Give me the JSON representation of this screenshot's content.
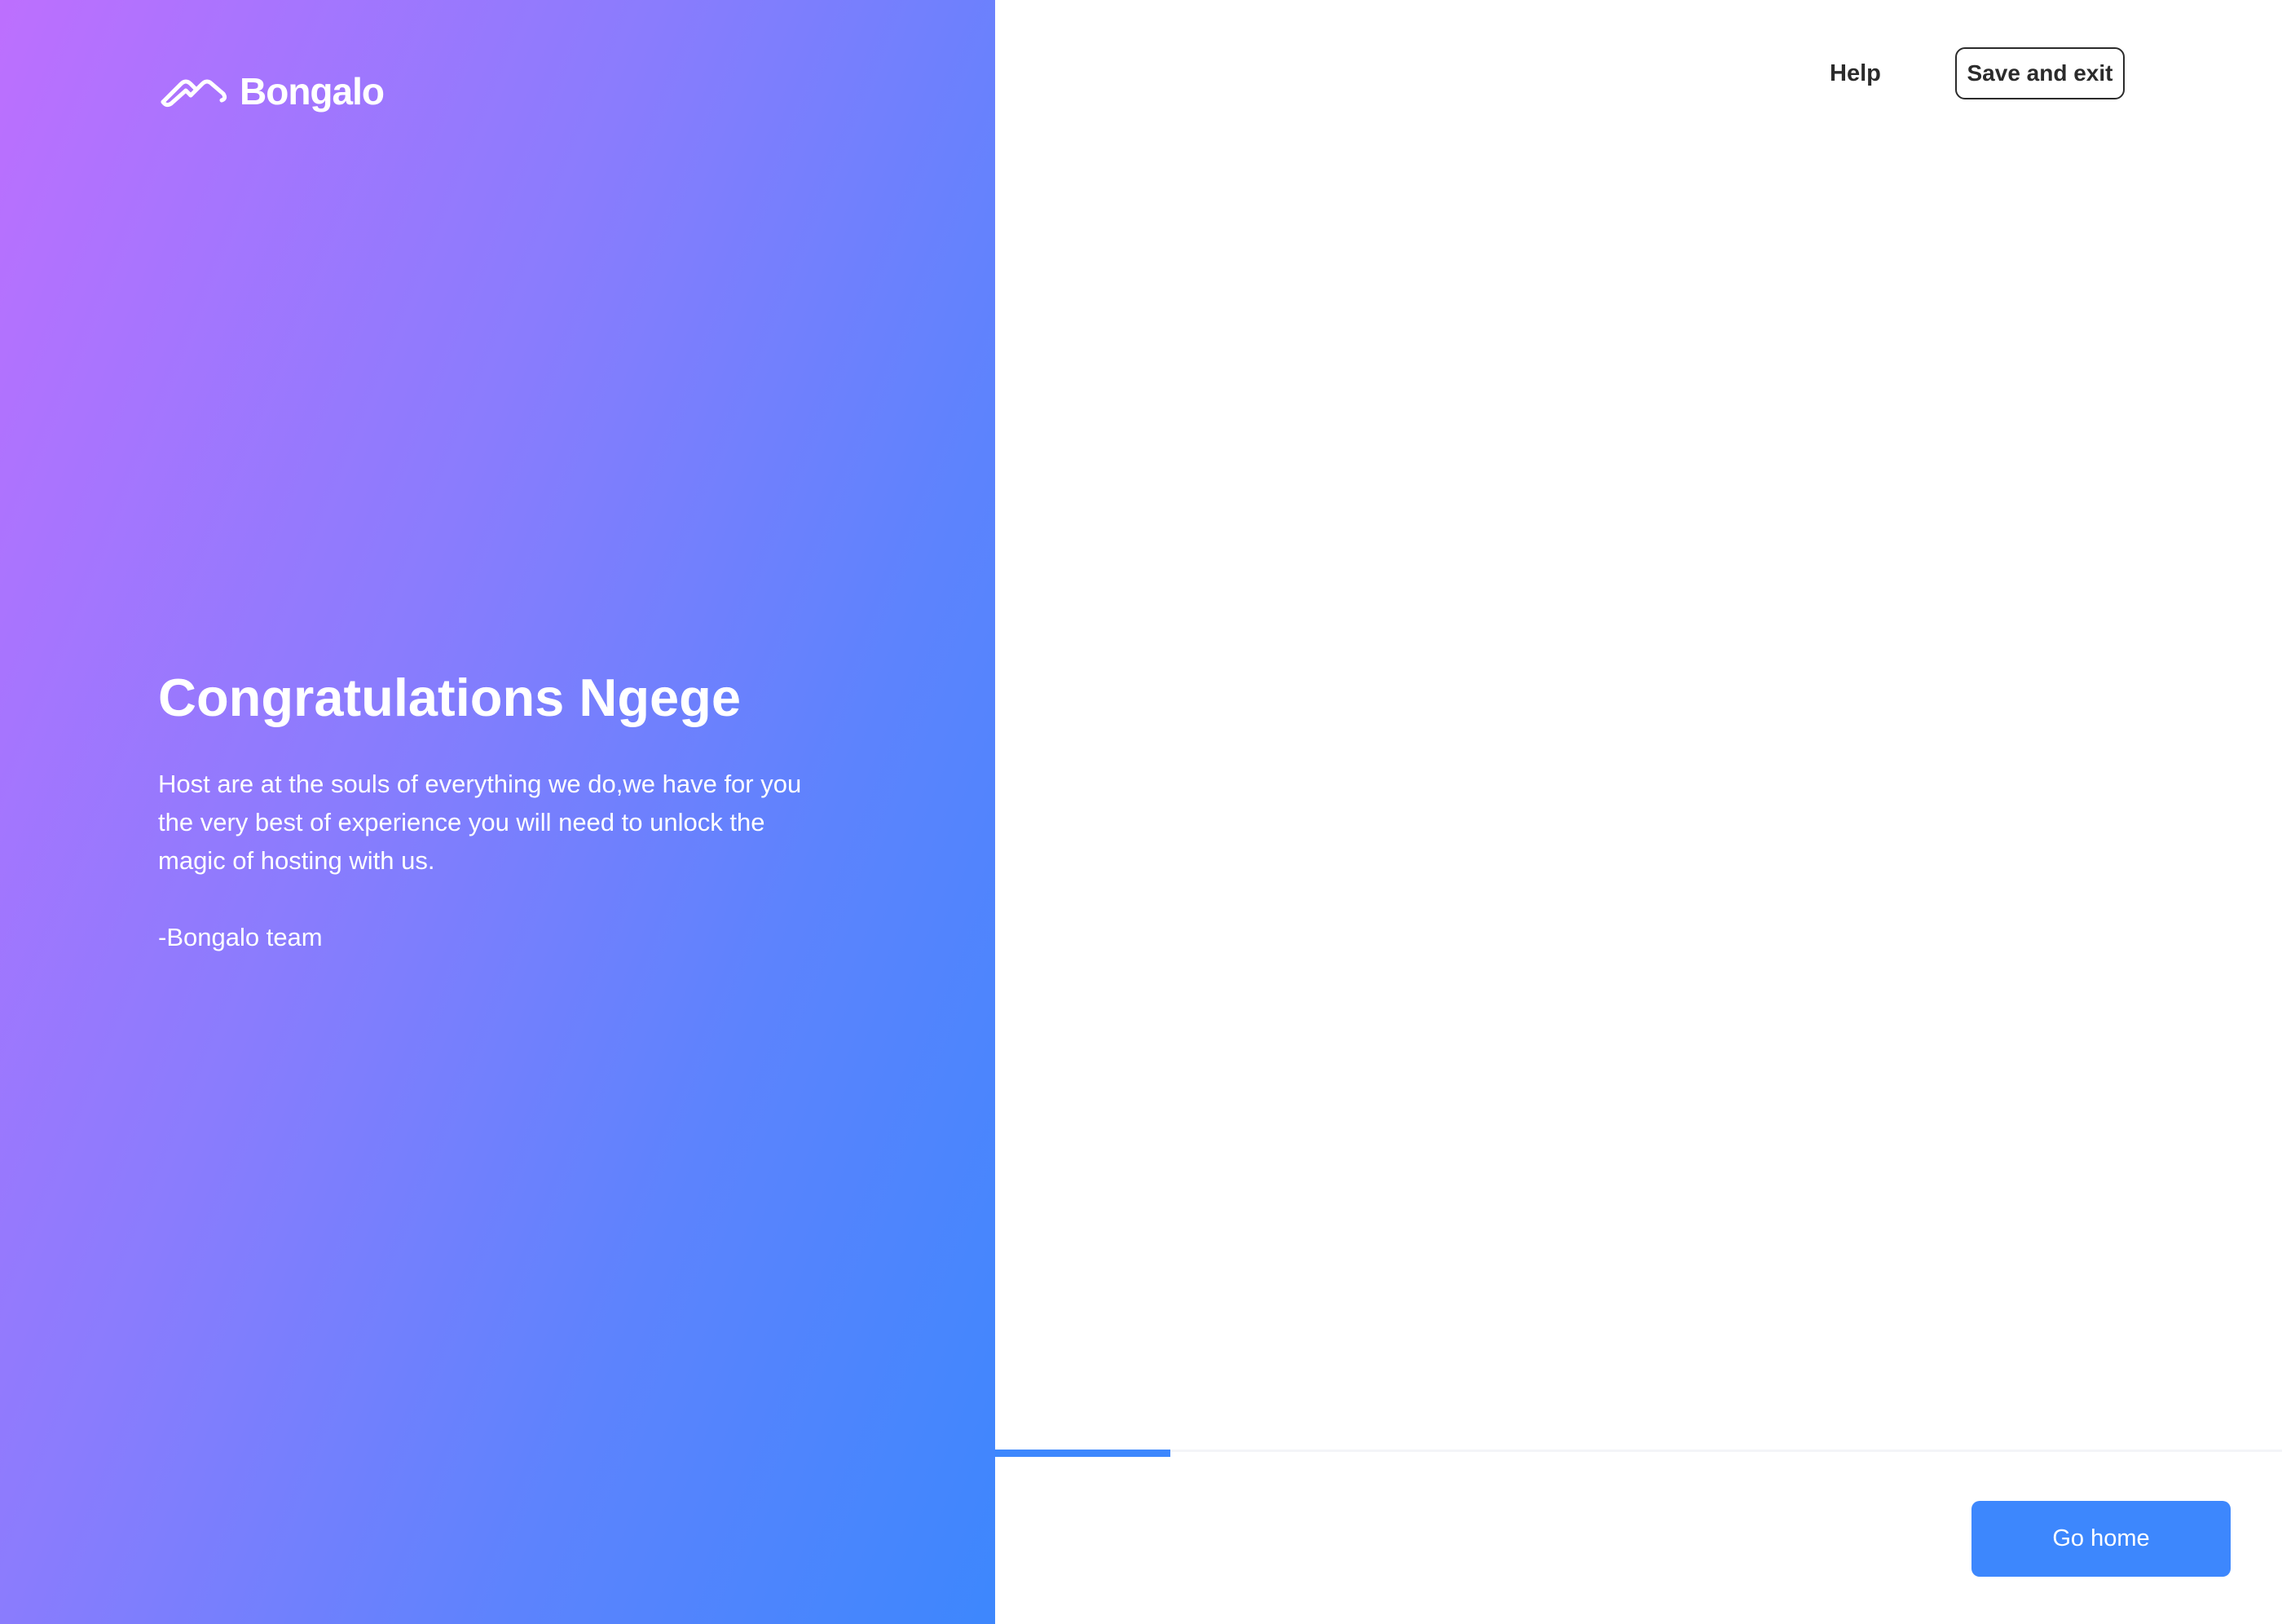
{
  "brand": {
    "name": "Bongalo",
    "logo_icon": "bongalo-roof-icon"
  },
  "header": {
    "help_label": "Help",
    "save_exit_label": "Save and exit"
  },
  "hero": {
    "title": "Congratulations Ngege",
    "body": "Host are at the souls of everything we do,we have for you the very best of experience you will need to unlock the magic of hosting with us.",
    "signature": "-Bongalo team"
  },
  "progress": {
    "fraction": 0.136
  },
  "footer": {
    "go_home_label": "Go home"
  },
  "colors": {
    "gradient_start": "#bd6ffe",
    "gradient_end": "#3d87fd",
    "accent": "#3d87fd",
    "text_dark": "#2b2b2b"
  }
}
